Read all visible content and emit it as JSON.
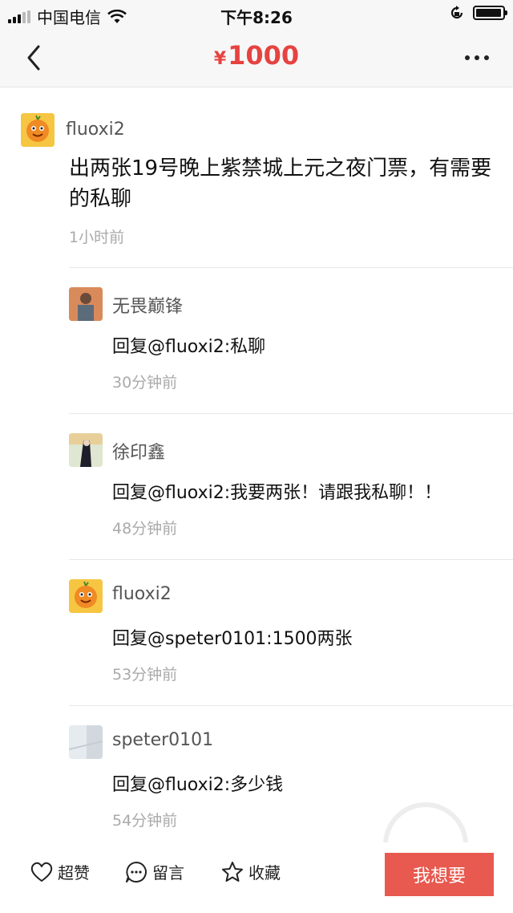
{
  "status_bar": {
    "carrier": "中国电信",
    "time": "下午8:26"
  },
  "nav": {
    "currency_symbol": "¥",
    "price": "1000"
  },
  "post": {
    "username": "fluoxi2",
    "text": "出两张19号晚上紫禁城上元之夜门票，有需要的私聊",
    "time": "1小时前"
  },
  "replies": [
    {
      "username": "无畏巅锋",
      "text": "回复@fluoxi2:私聊",
      "time": "30分钟前"
    },
    {
      "username": "徐印鑫",
      "text": "回复@fluoxi2:我要两张！请跟我私聊！！",
      "time": "48分钟前"
    },
    {
      "username": "fluoxi2",
      "text": "回复@speter0101:1500两张",
      "time": "53分钟前"
    },
    {
      "username": "speter0101",
      "text": "回复@fluoxi2:多少钱",
      "time": "54分钟前"
    }
  ],
  "bottom": {
    "like_label": "超赞",
    "comment_label": "留言",
    "favorite_label": "收藏",
    "want_label": "我想要"
  },
  "colors": {
    "accent": "#e64340",
    "button": "#e8594f"
  }
}
